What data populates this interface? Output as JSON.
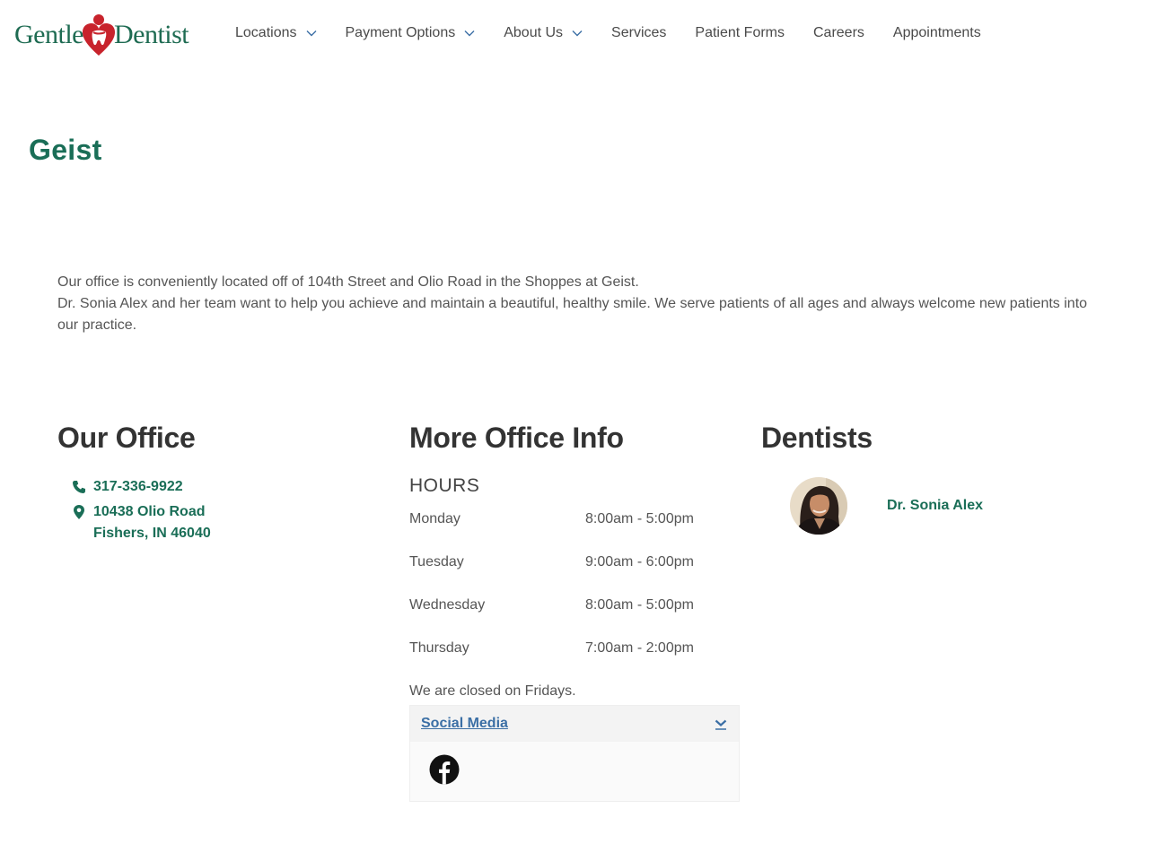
{
  "header": {
    "logo": {
      "left_text": "Gentle",
      "right_text": "Dentist",
      "icon": "heart-tooth-logo-icon"
    },
    "nav": [
      {
        "label": "Locations",
        "has_dropdown": true
      },
      {
        "label": "Payment Options",
        "has_dropdown": true
      },
      {
        "label": "About Us",
        "has_dropdown": true
      },
      {
        "label": "Services",
        "has_dropdown": false
      },
      {
        "label": "Patient Forms",
        "has_dropdown": false
      },
      {
        "label": "Careers",
        "has_dropdown": false
      },
      {
        "label": "Appointments",
        "has_dropdown": false
      }
    ]
  },
  "page": {
    "title": "Geist",
    "intro": [
      "Our office is conveniently located off of 104th Street and Olio Road in the Shoppes at Geist.",
      "Dr. Sonia Alex and her team want to help you achieve and maintain a beautiful, healthy smile. We serve patients of all ages and always welcome new patients into our practice."
    ]
  },
  "office": {
    "heading": "Our Office",
    "phone": "317-336-9922",
    "address_line1": "10438 Olio Road",
    "address_line2": "Fishers, IN 46040"
  },
  "info": {
    "heading": "More Office Info",
    "hours_label": "HOURS",
    "hours": [
      {
        "day": "Monday",
        "time": "8:00am - 5:00pm"
      },
      {
        "day": "Tuesday",
        "time": "9:00am - 6:00pm"
      },
      {
        "day": "Wednesday",
        "time": "8:00am - 5:00pm"
      },
      {
        "day": "Thursday",
        "time": "7:00am - 2:00pm"
      }
    ],
    "closed_note": "We are closed on Fridays.",
    "social": {
      "title": "Social Media",
      "links": [
        "facebook"
      ]
    }
  },
  "dentists": {
    "heading": "Dentists",
    "list": [
      {
        "name": "Dr. Sonia Alex"
      }
    ]
  },
  "colors": {
    "brand_green": "#1a6e57",
    "logo_red": "#c8232c",
    "link_blue": "#3b6fa5",
    "heading_dark": "#333333"
  }
}
